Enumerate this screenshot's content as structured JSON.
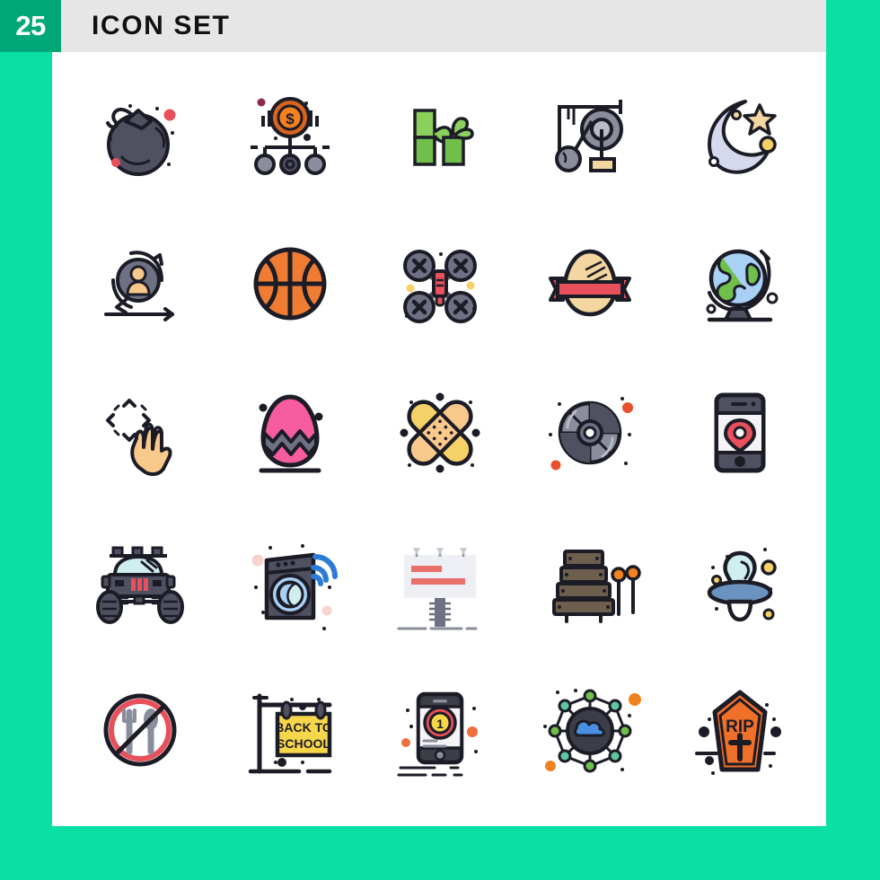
{
  "page": {
    "background_color": "#0AE0A4",
    "canvas_color": "#FFFFFF"
  },
  "header": {
    "count_badge": "25",
    "count_badge_bg": "#00A878",
    "title": "ICON SET",
    "title_bar_bg": "#E6E6E6",
    "title_color": "#111111"
  },
  "grid": {
    "columns": 5,
    "rows": 5,
    "icons": [
      {
        "name": "bomb-icon",
        "label": "Bomb",
        "row": 1,
        "col": 1
      },
      {
        "name": "crowdfunding-icon",
        "label": "Crowdfunding",
        "row": 1,
        "col": 2
      },
      {
        "name": "bamboo-icon",
        "label": "Bamboo",
        "row": 1,
        "col": 3
      },
      {
        "name": "pulley-icon",
        "label": "Pulley",
        "row": 1,
        "col": 4
      },
      {
        "name": "moon-star-icon",
        "label": "Moon and Star",
        "row": 1,
        "col": 5
      },
      {
        "name": "user-refresh-icon",
        "label": "User Refresh",
        "row": 2,
        "col": 1
      },
      {
        "name": "basketball-icon",
        "label": "Basketball",
        "row": 2,
        "col": 2
      },
      {
        "name": "drone-icon",
        "label": "Drone",
        "row": 2,
        "col": 3
      },
      {
        "name": "egg-ribbon-icon",
        "label": "Easter Egg Ribbon",
        "row": 2,
        "col": 4
      },
      {
        "name": "globe-stand-icon",
        "label": "Globe",
        "row": 2,
        "col": 5
      },
      {
        "name": "drag-gesture-icon",
        "label": "Drag Gesture",
        "row": 3,
        "col": 1
      },
      {
        "name": "easter-egg-icon",
        "label": "Easter Egg",
        "row": 3,
        "col": 2
      },
      {
        "name": "bandage-icon",
        "label": "Bandage",
        "row": 3,
        "col": 3
      },
      {
        "name": "compact-disc-icon",
        "label": "Compact Disc",
        "row": 3,
        "col": 4
      },
      {
        "name": "mobile-location-icon",
        "label": "Mobile Location",
        "row": 3,
        "col": 5
      },
      {
        "name": "monster-truck-icon",
        "label": "Monster Truck",
        "row": 4,
        "col": 1
      },
      {
        "name": "smart-washer-icon",
        "label": "Smart Washer",
        "row": 4,
        "col": 2
      },
      {
        "name": "billboard-icon",
        "label": "Billboard",
        "row": 4,
        "col": 3
      },
      {
        "name": "xylophone-icon",
        "label": "Xylophone",
        "row": 4,
        "col": 4
      },
      {
        "name": "pacifier-icon",
        "label": "Pacifier",
        "row": 4,
        "col": 5
      },
      {
        "name": "no-food-icon",
        "label": "No Food",
        "row": 5,
        "col": 1
      },
      {
        "name": "back-to-school-icon",
        "label": "Back To School",
        "row": 5,
        "col": 2
      },
      {
        "name": "mobile-ranking-icon",
        "label": "Mobile Ranking",
        "row": 5,
        "col": 3
      },
      {
        "name": "cloud-network-icon",
        "label": "Cloud Network",
        "row": 5,
        "col": 4
      },
      {
        "name": "coffin-icon",
        "label": "Coffin RIP",
        "row": 5,
        "col": 5
      }
    ],
    "icon_texts": {
      "dollar_symbol": "$",
      "back_to_school_line1": "BACK TO",
      "back_to_school_line2": "SCHOOL",
      "rip_text": "RIP",
      "rank_number": "1"
    },
    "palette": {
      "outline": "#1C1C27",
      "slate": "#4F5160",
      "slate_light": "#6E7183",
      "gray": "#8A8D9B",
      "gray_light": "#B9BCC6",
      "red": "#E8505B",
      "crimson": "#E84C5A",
      "orange": "#F07C33",
      "orange_dark": "#D9641E",
      "orange_bright": "#F5821F",
      "yellow": "#F9D423",
      "yellow_soft": "#F6D167",
      "peach": "#F9C98C",
      "sand": "#F3D6A0",
      "green": "#6FBF4A",
      "green_light": "#8CD05C",
      "green_mid": "#7EC24E",
      "pink": "#F75C9E",
      "blue_light": "#A9D0F5",
      "blue": "#4A90E2",
      "blue_pale": "#CFEFEF",
      "brown": "#6E5E4E",
      "lavender": "#D6D9EE"
    }
  }
}
